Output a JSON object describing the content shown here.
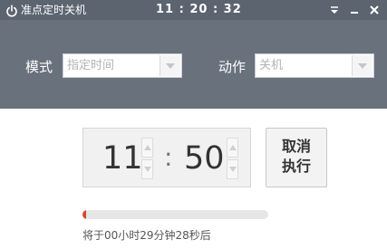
{
  "window": {
    "title": "准点定时关机",
    "clock": "11 : 20 : 32",
    "icons": {
      "power": "power-icon",
      "menu": "menu-icon",
      "minimize": "minimize-icon",
      "close": "close-icon"
    }
  },
  "settings": {
    "mode_label": "模式",
    "mode_value": "指定时间",
    "action_label": "动作",
    "action_value": "关机"
  },
  "timer": {
    "hours": "11",
    "separator": ":",
    "minutes": "50",
    "progress_percent": 1
  },
  "execute_button": {
    "line1": "取消",
    "line2": "执行"
  },
  "status": "将于00小时29分钟28秒后",
  "colors": {
    "titlebar": "#5c6470",
    "header": "#69717d",
    "progress": "#d9472b"
  }
}
